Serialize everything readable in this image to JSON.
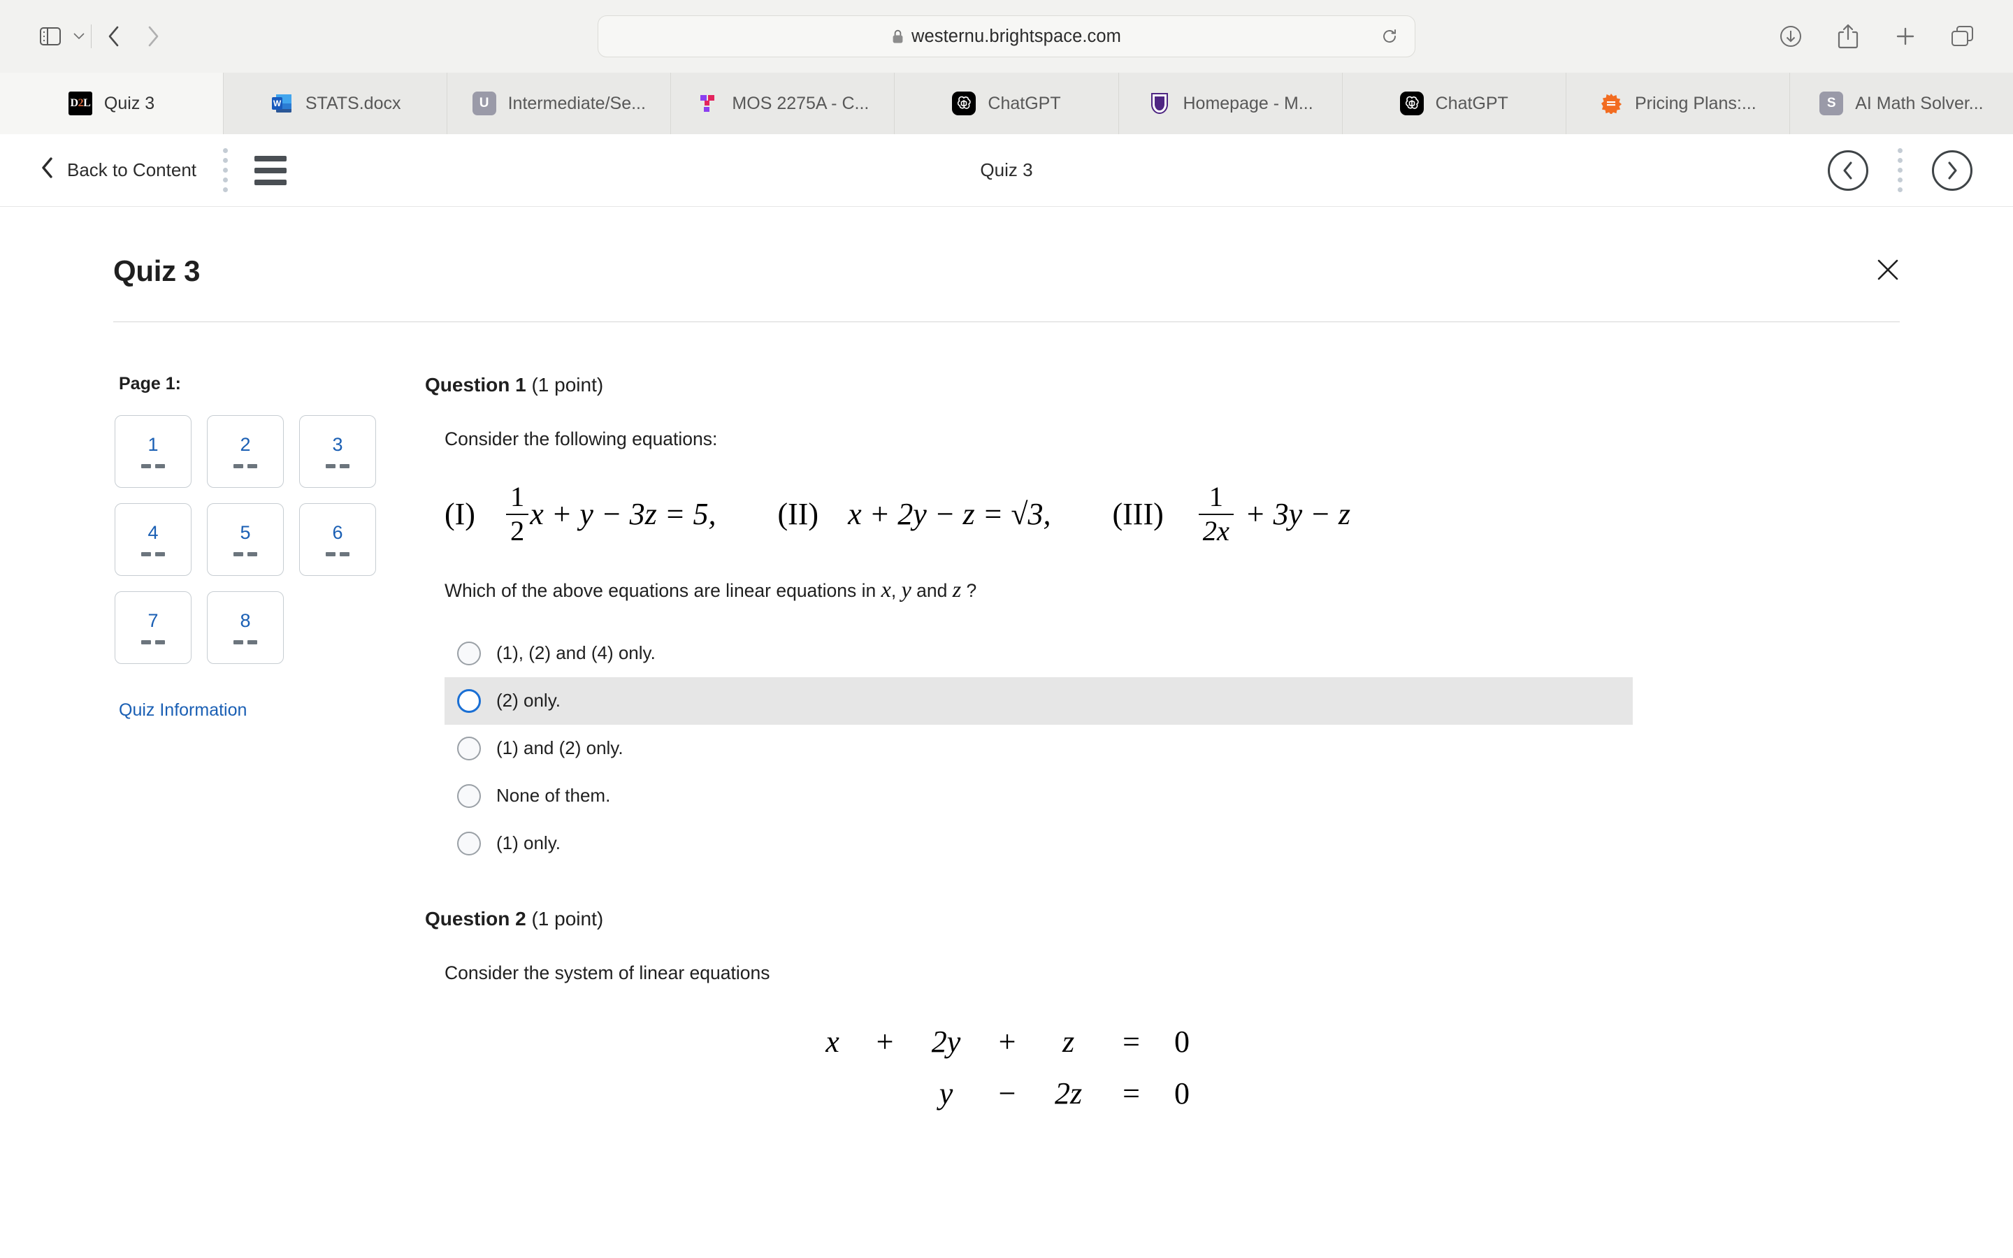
{
  "browser": {
    "url": "westernu.brightspace.com",
    "lock_icon": "lock-icon",
    "reload_icon": "reload-icon",
    "sidebar_icon": "sidebar-toggle-icon",
    "back_icon": "back-arrow-icon",
    "forward_icon": "forward-arrow-icon",
    "download_icon": "download-icon",
    "share_icon": "share-icon",
    "newtab_icon": "plus-icon",
    "tabs_overview_icon": "tab-overview-icon",
    "tabs": [
      {
        "label": "Quiz 3",
        "favicon": "d2l-icon",
        "active": true
      },
      {
        "label": "STATS.docx",
        "favicon": "word-icon",
        "active": false
      },
      {
        "label": "Intermediate/Se...",
        "favicon": "unacademy-icon",
        "active": false
      },
      {
        "label": "MOS 2275A - C...",
        "favicon": "mos-icon",
        "active": false
      },
      {
        "label": "ChatGPT",
        "favicon": "chatgpt-icon",
        "active": false
      },
      {
        "label": "Homepage - M...",
        "favicon": "western-crest-icon",
        "active": false
      },
      {
        "label": "ChatGPT",
        "favicon": "chatgpt-icon",
        "active": false
      },
      {
        "label": "Pricing Plans:...",
        "favicon": "pricing-sun-icon",
        "active": false
      },
      {
        "label": "AI Math Solver...",
        "favicon": "smodin-icon",
        "active": false
      }
    ]
  },
  "quiz_header": {
    "back_label": "Back to Content",
    "title": "Quiz 3",
    "menu_icon": "hamburger-icon",
    "prev_icon": "chevron-left-circle-icon",
    "next_icon": "chevron-right-circle-icon",
    "more_icon": "vertical-dots-icon"
  },
  "page": {
    "title": "Quiz 3",
    "close_icon": "close-icon"
  },
  "question_nav": {
    "heading": "Page 1:",
    "items": [
      {
        "number": "1",
        "status": "--"
      },
      {
        "number": "2",
        "status": "--"
      },
      {
        "number": "3",
        "status": "--"
      },
      {
        "number": "4",
        "status": "--"
      },
      {
        "number": "5",
        "status": "--"
      },
      {
        "number": "6",
        "status": "--"
      },
      {
        "number": "7",
        "status": "--"
      },
      {
        "number": "8",
        "status": "--"
      }
    ],
    "quiz_information_label": "Quiz Information"
  },
  "question1": {
    "heading_bold": "Question 1",
    "heading_points": "(1 point)",
    "prompt": "Consider the following equations:",
    "equations": [
      {
        "label": "(I)",
        "coef_num": "1",
        "coef_den": "2",
        "rest": "x + y − 3z = 5,"
      },
      {
        "label": "(II)",
        "expr": "x + 2y − z = √3,"
      },
      {
        "label": "(III)",
        "coef_num": "1",
        "coef_den": "2x",
        "rest": "+ 3y − z"
      }
    ],
    "question_text_pre": "Which of the above equations are linear equations in ",
    "question_var1": "x",
    "question_sep1": ", ",
    "question_var2": "y",
    "question_sep2": " and ",
    "question_var3": "z",
    "question_text_post": " ?",
    "options": [
      {
        "label": "(1), (2) and (4) only.",
        "selected": false,
        "highlighted": false
      },
      {
        "label": "(2) only.",
        "selected": false,
        "highlighted": true
      },
      {
        "label": "(1) and (2) only.",
        "selected": false,
        "highlighted": false
      },
      {
        "label": "None of them.",
        "selected": false,
        "highlighted": false
      },
      {
        "label": "(1) only.",
        "selected": false,
        "highlighted": false
      }
    ]
  },
  "question2": {
    "heading_bold": "Question 2",
    "heading_points": "(1 point)",
    "prompt": "Consider the system of linear equations",
    "system": [
      {
        "t1": "x",
        "op1": "+",
        "t2": "2y",
        "op2": "+",
        "t3": "z",
        "eq": "=",
        "rhs": "0"
      },
      {
        "t1": "",
        "op1": "",
        "t2": "y",
        "op2": "−",
        "t3": "2z",
        "eq": "=",
        "rhs": "0"
      }
    ]
  },
  "colors": {
    "accent_orange": "#e8751a",
    "link_blue": "#1a5fb4",
    "radio_focus_blue": "#1a6fd4",
    "highlight_gray": "#e6e6e6"
  }
}
